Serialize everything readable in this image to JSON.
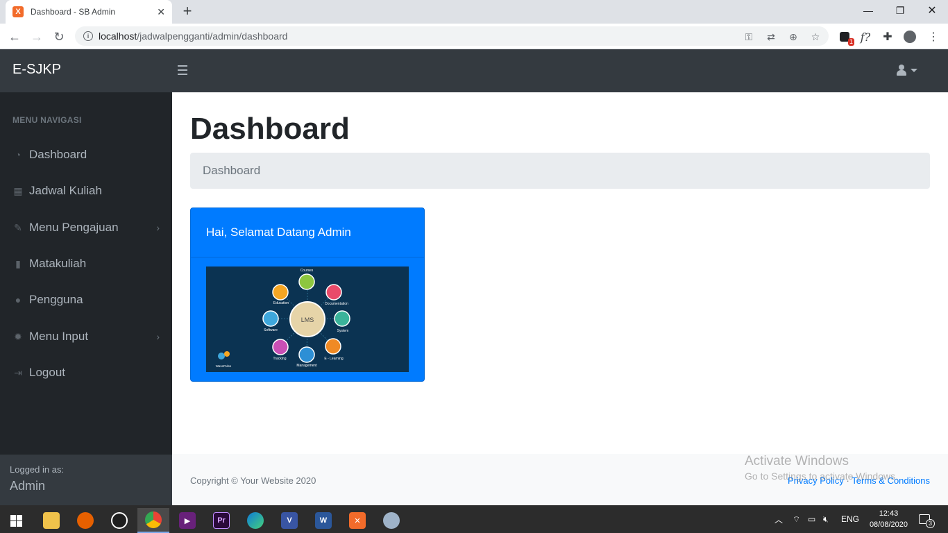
{
  "browser": {
    "tab_title": "Dashboard - SB Admin",
    "tab_favicon": "X",
    "url_host": "localhost",
    "url_path": "/jadwalpengganti/admin/dashboard",
    "extension_badge": "1",
    "fx_label": "f?"
  },
  "topnav": {
    "brand": "E-SJKP"
  },
  "sidebar": {
    "heading": "MENU NAVIGASI",
    "items": [
      {
        "label": "Dashboard",
        "icon": "dashboard-icon"
      },
      {
        "label": "Jadwal Kuliah",
        "icon": "calendar-icon"
      },
      {
        "label": "Menu Pengajuan",
        "icon": "pencil-icon"
      },
      {
        "label": "Matakuliah",
        "icon": "book-icon"
      },
      {
        "label": "Pengguna",
        "icon": "user-icon"
      },
      {
        "label": "Menu Input",
        "icon": "gear-icon"
      },
      {
        "label": "Logout",
        "icon": "logout-icon"
      }
    ],
    "logged_in_label": "Logged in as:",
    "logged_in_user": "Admin"
  },
  "main": {
    "title": "Dashboard",
    "breadcrumb": "Dashboard",
    "card": {
      "header": "Hai, Selamat Datang Admin",
      "image_labels": {
        "center": "LMS",
        "nodes": [
          "Courses",
          "Documentation",
          "System",
          "E - Learning",
          "Management",
          "Tracking",
          "Software",
          "Education"
        ],
        "logo": "WavePulse"
      }
    },
    "footer": {
      "copyright": "Copyright © Your Website 2020",
      "privacy": "Privacy Policy",
      "separator": "·",
      "terms": "Terms & Conditions"
    },
    "watermark": {
      "line1": "Activate Windows",
      "line2": "Go to Settings to activate Windows."
    }
  },
  "taskbar": {
    "lang": "ENG",
    "time": "12:43",
    "date": "08/08/2020",
    "notifications": "3"
  },
  "colors": {
    "primary": "#007bff",
    "topbar": "#343a40",
    "sidebar": "#212529"
  }
}
